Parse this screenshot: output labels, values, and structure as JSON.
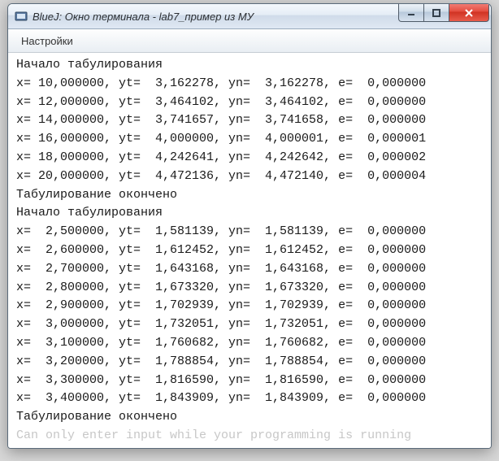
{
  "window": {
    "title": "BlueJ: Окно терминала - lab7_пример из МУ"
  },
  "menubar": {
    "settings": "Настройки"
  },
  "terminal": {
    "header1": "Начало табулирования",
    "footer1": "Табулирование окончено",
    "header2": "Начало табулирования",
    "footer2": "Табулирование окончено",
    "rows1": [
      {
        "x": "10,000000",
        "yt": "3,162278",
        "yn": "3,162278",
        "e": "0,000000"
      },
      {
        "x": "12,000000",
        "yt": "3,464102",
        "yn": "3,464102",
        "e": "0,000000"
      },
      {
        "x": "14,000000",
        "yt": "3,741657",
        "yn": "3,741658",
        "e": "0,000000"
      },
      {
        "x": "16,000000",
        "yt": "4,000000",
        "yn": "4,000001",
        "e": "0,000001"
      },
      {
        "x": "18,000000",
        "yt": "4,242641",
        "yn": "4,242642",
        "e": "0,000002"
      },
      {
        "x": "20,000000",
        "yt": "4,472136",
        "yn": "4,472140",
        "e": "0,000004"
      }
    ],
    "rows2": [
      {
        "x": "2,500000",
        "yt": "1,581139",
        "yn": "1,581139",
        "e": "0,000000"
      },
      {
        "x": "2,600000",
        "yt": "1,612452",
        "yn": "1,612452",
        "e": "0,000000"
      },
      {
        "x": "2,700000",
        "yt": "1,643168",
        "yn": "1,643168",
        "e": "0,000000"
      },
      {
        "x": "2,800000",
        "yt": "1,673320",
        "yn": "1,673320",
        "e": "0,000000"
      },
      {
        "x": "2,900000",
        "yt": "1,702939",
        "yn": "1,702939",
        "e": "0,000000"
      },
      {
        "x": "3,000000",
        "yt": "1,732051",
        "yn": "1,732051",
        "e": "0,000000"
      },
      {
        "x": "3,100000",
        "yt": "1,760682",
        "yn": "1,760682",
        "e": "0,000000"
      },
      {
        "x": "3,200000",
        "yt": "1,788854",
        "yn": "1,788854",
        "e": "0,000000"
      },
      {
        "x": "3,300000",
        "yt": "1,816590",
        "yn": "1,816590",
        "e": "0,000000"
      },
      {
        "x": "3,400000",
        "yt": "1,843909",
        "yn": "1,843909",
        "e": "0,000000"
      }
    ],
    "hint": "Can only enter input while your programming is running"
  }
}
